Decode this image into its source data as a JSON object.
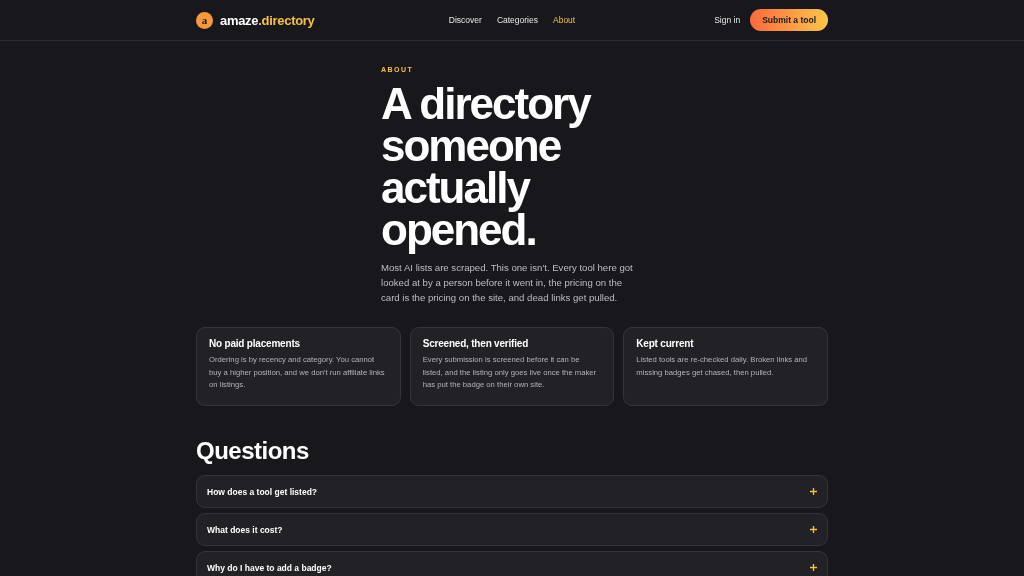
{
  "header": {
    "logo_letter": "a",
    "brand_name": "amaze",
    "brand_suffix": ".directory",
    "nav": [
      {
        "label": "Discover",
        "selected": false
      },
      {
        "label": "Categories",
        "selected": false
      },
      {
        "label": "About",
        "selected": true
      }
    ],
    "sign_in": "Sign in",
    "submit": "Submit a tool"
  },
  "hero": {
    "eyebrow": "ABOUT",
    "title_lines": [
      "A directory",
      "someone",
      "actually",
      "opened."
    ],
    "intro": "Most AI lists are scraped. This one isn't. Every tool here got looked at by a person before it went in, the pricing on the card is the pricing on the site, and dead links get pulled."
  },
  "cards": [
    {
      "title": "No paid placements",
      "body": "Ordering is by recency and category. You cannot buy a higher position, and we don't run affiliate links on listings."
    },
    {
      "title": "Screened, then verified",
      "body": "Every submission is screened before it can be listed, and the listing only goes live once the maker has put the badge on their own site."
    },
    {
      "title": "Kept current",
      "body": "Listed tools are re-checked daily. Broken links and missing badges get chased, then pulled."
    }
  ],
  "questions": {
    "title": "Questions",
    "items": [
      {
        "question": "How does a tool get listed?",
        "expanded": false
      },
      {
        "question": "What does it cost?",
        "expanded": false
      },
      {
        "question": "Why do I have to add a badge?",
        "expanded": false
      }
    ]
  }
}
